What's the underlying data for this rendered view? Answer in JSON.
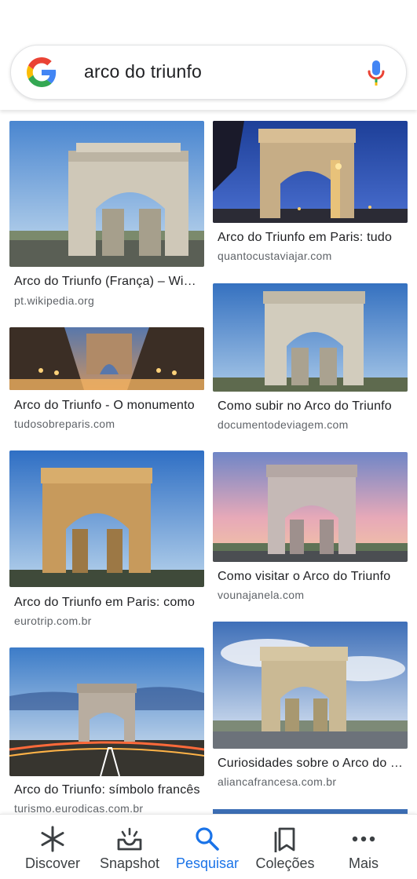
{
  "search": {
    "query": "arco do triunfo",
    "logo": "google-g-logo",
    "mic_icon": "microphone-icon"
  },
  "results": [
    {
      "title": "Arco do Triunfo (França) – Wikipédia",
      "source": "pt.wikipedia.org"
    },
    {
      "title": "Arco do Triunfo em Paris: tudo",
      "source": "quantocustaviajar.com"
    },
    {
      "title": "Arco do Triunfo - O monumento",
      "source": "tudosobreparis.com"
    },
    {
      "title": "Como subir no Arco do Triunfo",
      "source": "documentodeviagem.com"
    },
    {
      "title": "Arco do Triunfo em Paris: como",
      "source": "eurotrip.com.br"
    },
    {
      "title": "Como visitar o Arco do Triunfo",
      "source": "vounajanela.com"
    },
    {
      "title": "Arco do Triunfo: símbolo francês",
      "source": "turismo.eurodicas.com.br"
    },
    {
      "title": "Curiosidades sobre o Arco do Triunfo",
      "source": "aliancafrancesa.com.br"
    }
  ],
  "nav": [
    {
      "label": "Discover",
      "icon": "asterisk-icon"
    },
    {
      "label": "Snapshot",
      "icon": "snapshot-tray-icon"
    },
    {
      "label": "Pesquisar",
      "icon": "search-icon",
      "active": true
    },
    {
      "label": "Coleções",
      "icon": "bookmarks-icon"
    },
    {
      "label": "Mais",
      "icon": "more-dots-icon"
    }
  ],
  "colors": {
    "accent": "#1a73e8",
    "text": "#202124",
    "source_text": "#5f6368"
  }
}
